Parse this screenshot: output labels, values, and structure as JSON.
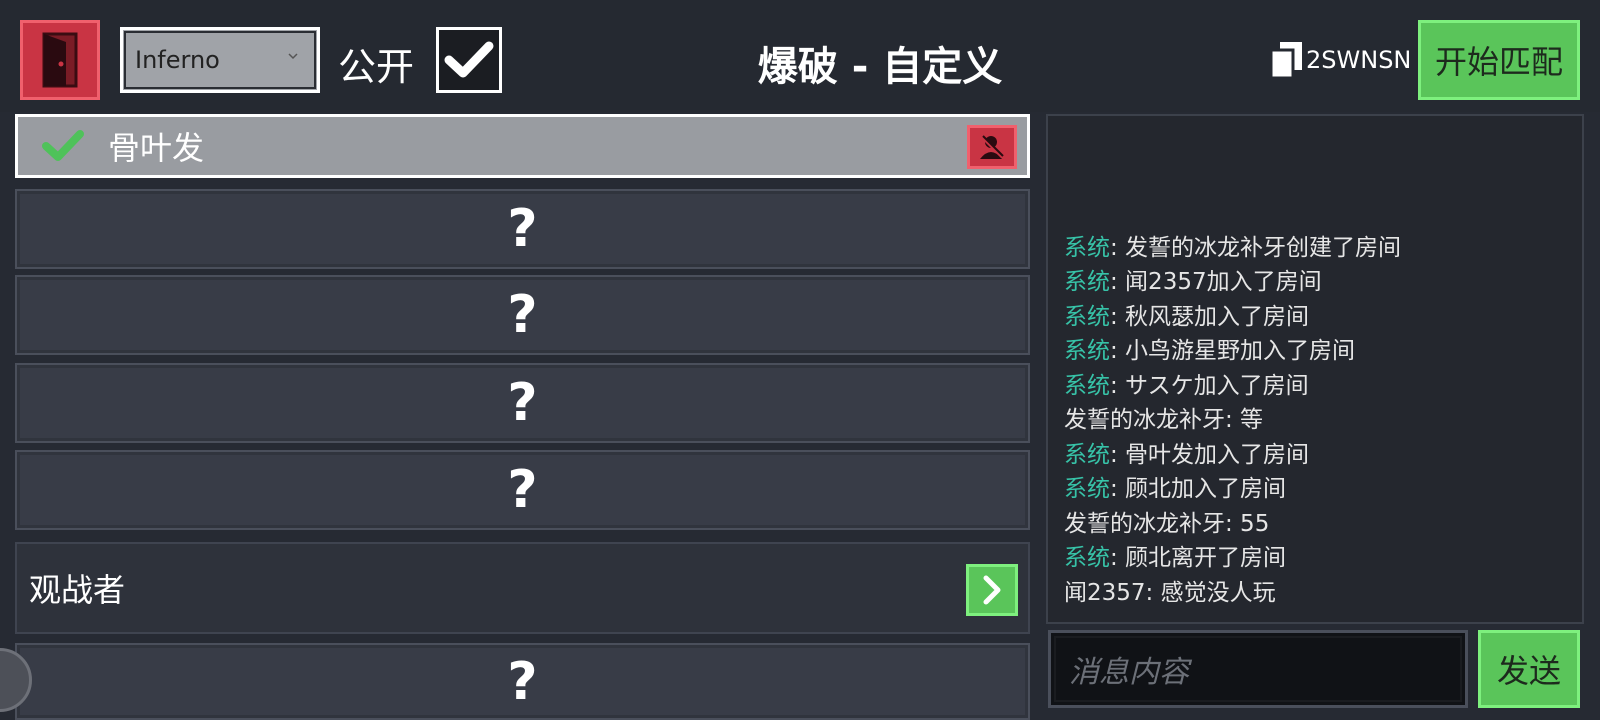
{
  "header": {
    "map_selected": "Inferno",
    "public_label": "公开",
    "public_checked": true,
    "mode_title": "爆破 - 自定义",
    "room_code": "2SWNSN",
    "start_button": "开始匹配"
  },
  "players": {
    "filled_name": "骨叶发",
    "empty_marker": "?"
  },
  "spectator": {
    "label": "观战者"
  },
  "chat": {
    "messages": [
      {
        "sender": "系统",
        "system": true,
        "text": ": 发誓的冰龙补牙创建了房间"
      },
      {
        "sender": "系统",
        "system": true,
        "text": ": 闻2357加入了房间"
      },
      {
        "sender": "系统",
        "system": true,
        "text": ": 秋风瑟加入了房间"
      },
      {
        "sender": "系统",
        "system": true,
        "text": ": 小鸟游星野加入了房间"
      },
      {
        "sender": "系统",
        "system": true,
        "text": ": サスケ加入了房间"
      },
      {
        "sender": "发誓的冰龙补牙",
        "system": false,
        "text": ": 等"
      },
      {
        "sender": "系统",
        "system": true,
        "text": ": 骨叶发加入了房间"
      },
      {
        "sender": "系统",
        "system": true,
        "text": ": 顾北加入了房间"
      },
      {
        "sender": "发誓的冰龙补牙",
        "system": false,
        "text": ": 55"
      },
      {
        "sender": "系统",
        "system": true,
        "text": ": 顾北离开了房间"
      },
      {
        "sender": "闻2357",
        "system": false,
        "text": ": 感觉没人玩"
      }
    ],
    "input_placeholder": "消息内容",
    "send_button": "发送"
  },
  "colors": {
    "background": "#262a33",
    "danger": "#c93444",
    "success": "#5ac55a",
    "system_text": "#37c3a8"
  },
  "icons": {
    "exit": "door-exit-icon",
    "copy": "copy-icon",
    "check": "checkmark-icon",
    "kick": "remove-user-icon",
    "arrow": "chevron-right-icon",
    "float": "floating-assistant-icon"
  }
}
